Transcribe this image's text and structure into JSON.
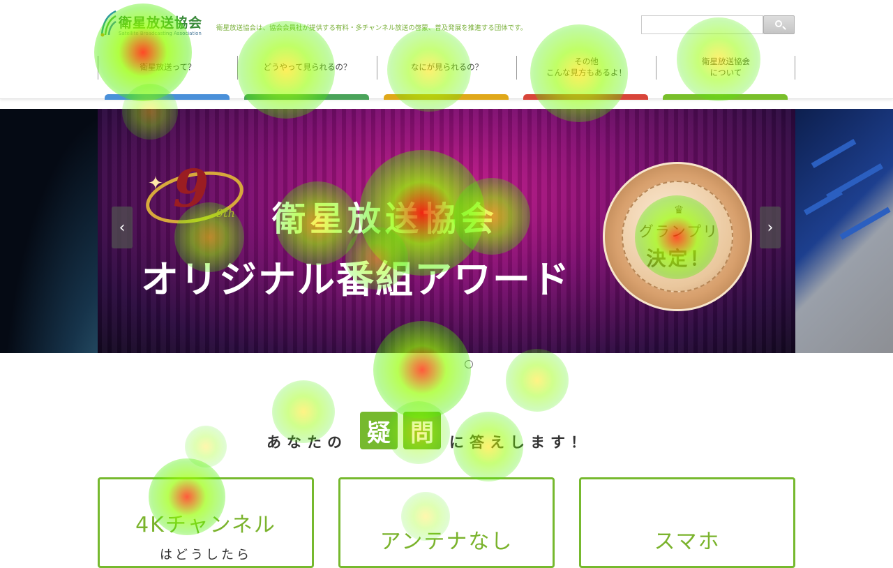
{
  "header": {
    "logo_title": "衛星放送協会",
    "logo_subtitle": "Satellite Broadcasting Association",
    "tagline": "衛星放送協会は、協会会員社が提供する有料・多チャンネル放送の啓蒙、普及発展を推進する団体です。",
    "search": {
      "value": "",
      "placeholder": ""
    },
    "search_icon": "search-icon"
  },
  "nav": {
    "items": [
      {
        "label": "衛星放送って？"
      },
      {
        "label": "どうやって見られるの？"
      },
      {
        "label": "なにが見られるの？"
      },
      {
        "label": "その他\nこんな見方もあるよ！"
      },
      {
        "label": "衛星放送協会\nについて"
      }
    ],
    "tab_colors": [
      "#4a90d9",
      "#4aa35a",
      "#e0a81a",
      "#d8453a",
      "#79bf2b"
    ]
  },
  "hero": {
    "award_badge": "9th",
    "award_line1": "衛星放送協会",
    "award_line2": "オリジナル番組アワード",
    "medal_line1": "グランプリ",
    "medal_line2": "決定！",
    "prev_icon": "chevron-left-icon",
    "next_icon": "chevron-right-icon",
    "slide_count": 1
  },
  "question": {
    "prefix": "あなたの",
    "badge1": "疑",
    "badge2": "問",
    "suffix": "に答えします！"
  },
  "cards": [
    {
      "title": "4Kチャンネル",
      "subtitle": "はどうしたら"
    },
    {
      "title": "アンテナなし",
      "subtitle": ""
    },
    {
      "title": "スマホ",
      "subtitle": ""
    }
  ],
  "colors": {
    "accent_green": "#76b92e",
    "hero_purple": "#7c0d6f"
  }
}
